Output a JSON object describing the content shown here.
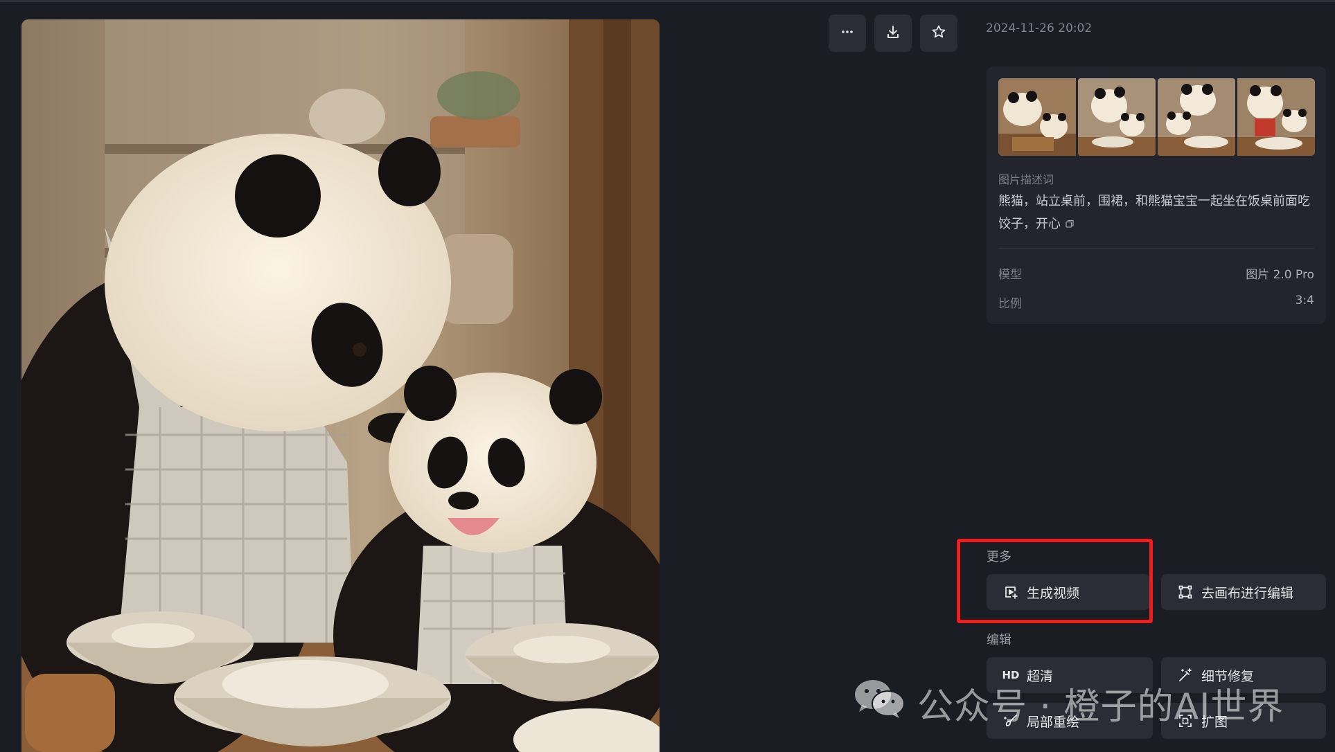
{
  "toolbar": {
    "more_icon": "more-horizontal-icon",
    "download_icon": "download-icon",
    "favorite_icon": "star-icon"
  },
  "timestamp": "2024-11-26 20:02",
  "info": {
    "description_label": "图片描述词",
    "description_text": "熊猫，站立桌前，围裙，和熊猫宝宝一起坐在饭桌前面吃饺子，开心",
    "model_label": "模型",
    "model_value": "图片 2.0 Pro",
    "ratio_label": "比例",
    "ratio_value": "3:4"
  },
  "more_section": {
    "title": "更多",
    "buttons": [
      {
        "label": "生成视频",
        "icon": "video-generate-icon"
      },
      {
        "label": "去画布进行编辑",
        "icon": "canvas-edit-icon"
      }
    ]
  },
  "edit_section": {
    "title": "编辑",
    "buttons": [
      {
        "label": "超清",
        "icon": "hd-icon",
        "icon_text": "HD"
      },
      {
        "label": "细节修复",
        "icon": "magic-wand-icon"
      },
      {
        "label": "局部重绘",
        "icon": "brush-icon"
      },
      {
        "label": "扩图",
        "icon": "expand-icon"
      }
    ]
  },
  "watermark": {
    "text": "公众号 · 橙子的AI世界",
    "icon": "wechat-icon"
  },
  "colors": {
    "background": "#1b1d24",
    "card": "#22252e",
    "button": "#2a2d36",
    "highlight": "#f01d1d"
  }
}
